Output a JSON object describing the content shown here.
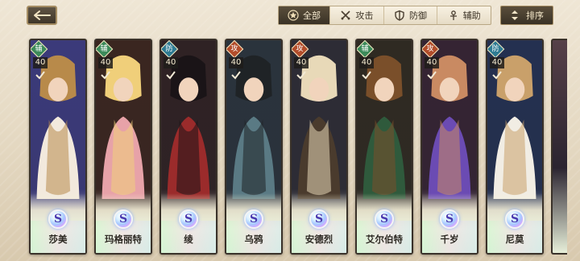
{
  "header": {
    "back_icon": "left-arrow-icon",
    "filters": [
      {
        "label": "全部",
        "icon": "star-circle-icon",
        "active": true
      },
      {
        "label": "攻击",
        "icon": "crossed-swords-icon",
        "active": false
      },
      {
        "label": "防御",
        "icon": "shield-icon",
        "active": false
      },
      {
        "label": "辅助",
        "icon": "wand-icon",
        "active": false
      }
    ],
    "sort_label": "排序",
    "sort_icon": "up-down-arrows-icon"
  },
  "characters": [
    {
      "name": "莎美",
      "role": "辅",
      "role_type": "support",
      "level": "40",
      "rank": "S",
      "palette": [
        "#3b3a7a",
        "#b88a4a",
        "#f2e9dd"
      ]
    },
    {
      "name": "玛格丽特",
      "role": "辅",
      "role_type": "support",
      "level": "40",
      "rank": "S",
      "palette": [
        "#3a2620",
        "#f0cf7a",
        "#e7a2a8"
      ]
    },
    {
      "name": "绫",
      "role": "防",
      "role_type": "defense",
      "level": "40",
      "rank": "S",
      "palette": [
        "#2f2224",
        "#1a1417",
        "#9b2b2b"
      ]
    },
    {
      "name": "乌鸦",
      "role": "攻",
      "role_type": "attack",
      "level": "40",
      "rank": "S",
      "palette": [
        "#2a333c",
        "#1f2326",
        "#5a7a84"
      ]
    },
    {
      "name": "安德烈",
      "role": "攻",
      "role_type": "attack",
      "level": "40",
      "rank": "S",
      "palette": [
        "#2d2c35",
        "#e8d9b8",
        "#4a3b2d"
      ]
    },
    {
      "name": "艾尔伯特",
      "role": "辅",
      "role_type": "support",
      "level": "40",
      "rank": "S",
      "palette": [
        "#2f2a22",
        "#7a4f2a",
        "#2f5a3c"
      ]
    },
    {
      "name": "千岁",
      "role": "攻",
      "role_type": "attack",
      "level": "40",
      "rank": "S",
      "palette": [
        "#352433",
        "#c98a62",
        "#6b4bb3"
      ]
    },
    {
      "name": "尼莫",
      "role": "防",
      "role_type": "defense",
      "level": "40",
      "rank": "S",
      "palette": [
        "#243050",
        "#c9a06a",
        "#f1ede4"
      ]
    }
  ]
}
